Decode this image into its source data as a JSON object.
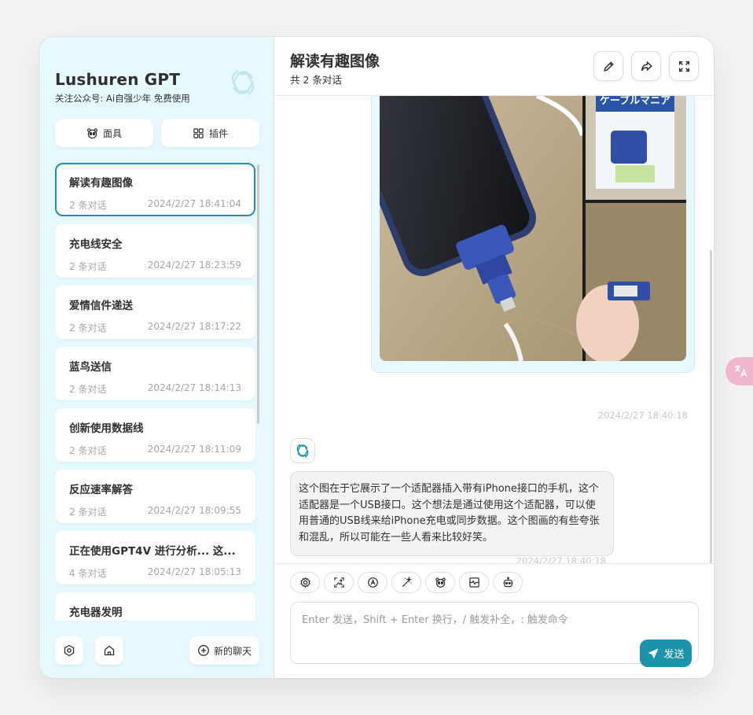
{
  "sidebar": {
    "title": "Lushuren GPT",
    "subtitle": "关注公众号: Ai自强少年 免费使用",
    "mask_button": "面具",
    "plugin_button": "插件",
    "new_chat_button": "新的聊天",
    "chats": [
      {
        "title": "解读有趣图像",
        "count": "2 条对话",
        "time": "2024/2/27 18:41:04"
      },
      {
        "title": "充电线安全",
        "count": "2 条对话",
        "time": "2024/2/27 18:23:59"
      },
      {
        "title": "爱情信件递送",
        "count": "2 条对话",
        "time": "2024/2/27 18:17:22"
      },
      {
        "title": "蓝鸟送信",
        "count": "2 条对话",
        "time": "2024/2/27 18:14:13"
      },
      {
        "title": "创新使用数据线",
        "count": "2 条对话",
        "time": "2024/2/27 18:11:09"
      },
      {
        "title": "反应速率解答",
        "count": "2 条对话",
        "time": "2024/2/27 18:09:55"
      },
      {
        "title": "正在使用GPT4V 进行分析... 这...",
        "count": "4 条对话",
        "time": "2024/2/27 18:05:13"
      },
      {
        "title": "充电器发明",
        "count": "",
        "time": ""
      }
    ]
  },
  "header": {
    "title": "解读有趣图像",
    "subtitle": "共 2 条对话"
  },
  "messages": {
    "user_time": "2024/2/27 18:40:18",
    "bot_text": "这个图在于它展示了一个适配器插入带有iPhone接口的手机，这个适配器是一个USB接口。这个想法是通过使用这个适配器，可以使用普通的USB线来给iPhone充电或同步数据。这个图画的有些夸张和混乱，所以可能在一些人看来比较好笑。",
    "bot_time": "2024/2/27 18:40:18",
    "photo_text": "ケーブルマニア"
  },
  "input": {
    "placeholder": "Enter 发送，Shift + Enter 换行，/ 触发补全，: 触发命令",
    "send_label": "发送"
  },
  "colors": {
    "accent": "#1d93ab",
    "sidebar_bg": "#e7f8ff",
    "fab": "#f0b6cd"
  }
}
